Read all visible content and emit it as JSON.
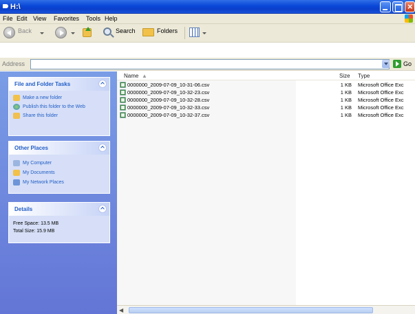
{
  "window": {
    "title": "H:\\"
  },
  "menu": [
    "File",
    "Edit",
    "View",
    "Favorites",
    "Tools",
    "Help"
  ],
  "toolbar": {
    "back": "Back",
    "search": "Search",
    "folders": "Folders"
  },
  "address": {
    "label": "Address",
    "go": "Go"
  },
  "tasks": {
    "file_folder": {
      "title": "File and Folder Tasks",
      "items": [
        "Make a new folder",
        "Publish this folder to the Web",
        "Share this folder"
      ]
    },
    "other_places": {
      "title": "Other Places",
      "items": [
        "My Computer",
        "My Documents",
        "My Network Places"
      ]
    },
    "details": {
      "title": "Details",
      "free_space": "Free Space: 13.5 MB",
      "total_size": "Total Size: 15.9 MB"
    }
  },
  "columns": {
    "name": "Name",
    "size": "Size",
    "type": "Type"
  },
  "files": [
    {
      "name": "0000000_2009-07-09_10-31-06.csv",
      "size": "1 KB",
      "type": "Microsoft Office Exc"
    },
    {
      "name": "0000000_2009-07-09_10-32-23.csv",
      "size": "1 KB",
      "type": "Microsoft Office Exc"
    },
    {
      "name": "0000000_2009-07-09_10-32-28.csv",
      "size": "1 KB",
      "type": "Microsoft Office Exc"
    },
    {
      "name": "0000000_2009-07-09_10-32-33.csv",
      "size": "1 KB",
      "type": "Microsoft Office Exc"
    },
    {
      "name": "0000000_2009-07-09_10-32-37.csv",
      "size": "1 KB",
      "type": "Microsoft Office Exc"
    }
  ]
}
